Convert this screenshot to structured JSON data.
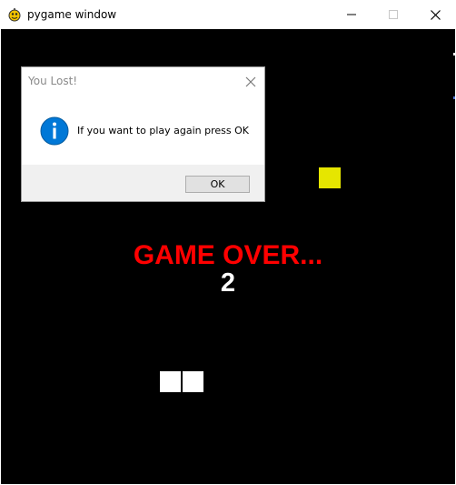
{
  "window": {
    "title": "pygame window",
    "icon": "pygame-snake-icon",
    "controls": {
      "minimize": "minimize-icon",
      "maximize": "maximize-icon",
      "close": "close-icon"
    }
  },
  "game": {
    "background_color": "#000000",
    "gameover_text": "GAME OVER...",
    "gameover_color": "#ff0000",
    "score": "2",
    "score_color": "#ffffff",
    "food_color": "#e6e600",
    "snake_color": "#ffffff",
    "snake_length": 2
  },
  "dialog": {
    "title": "You Lost!",
    "icon": "info-icon",
    "message": "If you want to play again press OK",
    "ok_label": "OK",
    "accent_color": "#0078d7"
  }
}
